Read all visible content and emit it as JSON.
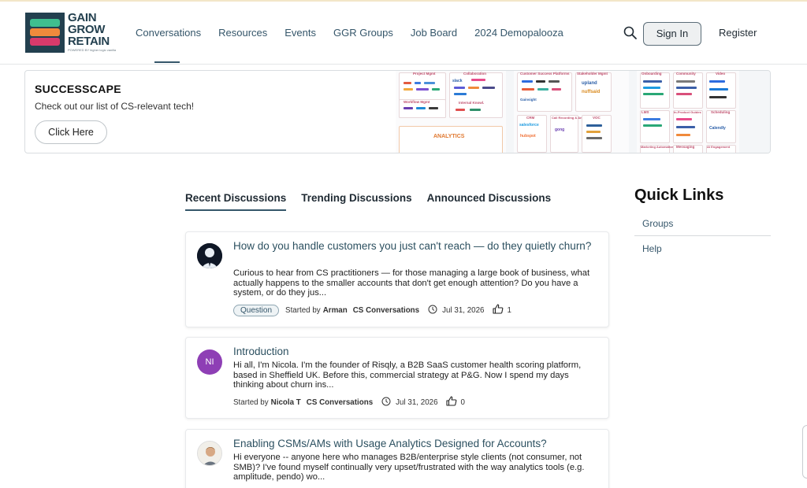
{
  "logo": {
    "lines": [
      "GAIN",
      "GROW",
      "RETAIN"
    ],
    "tagline": "POWERED BY higher logic vanilla"
  },
  "nav": {
    "items": [
      "Conversations",
      "Resources",
      "Events",
      "GGR Groups",
      "Job Board",
      "2024 Demopalooza"
    ],
    "active_index": 0,
    "search_icon": "search-icon",
    "sign_in": "Sign In",
    "register": "Register"
  },
  "banner": {
    "title": "SUCCESSCAPE",
    "subtitle": "Check out our list of CS-relevant tech!",
    "button": "Click Here",
    "landscape_headings": [
      "Project Mgmt",
      "Collaboration",
      "Customer Success Platforms",
      "Stakeholder Mgmt",
      "Onboarding",
      "Community",
      "Video",
      "ANALYTICS",
      "Workflow Mgmt",
      "Internal Knowl.",
      "CRM",
      "Call Recording & Analytics",
      "VOC",
      "LMS",
      "In-Product Guides",
      "Scheduling",
      "Marketing Automation",
      "Messaging",
      "AI Engagement"
    ],
    "landscape_logos": [
      "slack",
      "upland",
      "nuffsaid",
      "Gainsight",
      "gong",
      "Calendly",
      "salesforce",
      "hubspot"
    ]
  },
  "tabs": {
    "items": [
      "Recent Discussions",
      "Trending Discussions",
      "Announced Discussions"
    ],
    "active_index": 0
  },
  "discussions": [
    {
      "title": "How do you handle customers you just can't reach — do they quietly churn?",
      "excerpt": "Curious to hear from CS practitioners — for those managing a large book of business, what actually happens to the smaller accounts that don't get enough attention? Do you have a system, or do they jus...",
      "tag": "Question",
      "started_by_label": "Started by",
      "author": "Arman",
      "group": "CS Conversations",
      "date": "Jul 31, 2026",
      "likes": "1",
      "avatar_type": "photo-dark"
    },
    {
      "title": "Introduction",
      "excerpt": "Hi all, I'm Nicola. I'm the founder of Risqly, a B2B SaaS customer health scoring platform, based in Sheffield UK. Before this, commercial strategy at P&G. Now I spend my days thinking about churn ins...",
      "tag": "",
      "started_by_label": "Started by",
      "author": "Nicola T",
      "group": "CS Conversations",
      "date": "Jul 31, 2026",
      "likes": "0",
      "avatar_initials": "NI",
      "avatar_color": "#8e3fb5"
    },
    {
      "title": "Enabling CSMs/AMs with Usage Analytics Designed for Accounts?",
      "excerpt": "Hi everyone -- anyone here who manages B2B/enterprise style clients (not consumer, not SMB)? I've found myself continually very upset/frustrated with the way analytics tools (e.g. amplitude, pendo) wo...",
      "avatar_type": "photo-light"
    }
  ],
  "quick_links": {
    "title": "Quick Links",
    "items": [
      "Groups",
      "Help"
    ]
  },
  "colors": {
    "brand_navy": "#23404f",
    "nav_text": "#35566a",
    "title_link": "#2c5060",
    "logo_green": "#3fbf8f",
    "logo_orange": "#f08a3c",
    "logo_pink": "#d93a6b"
  }
}
